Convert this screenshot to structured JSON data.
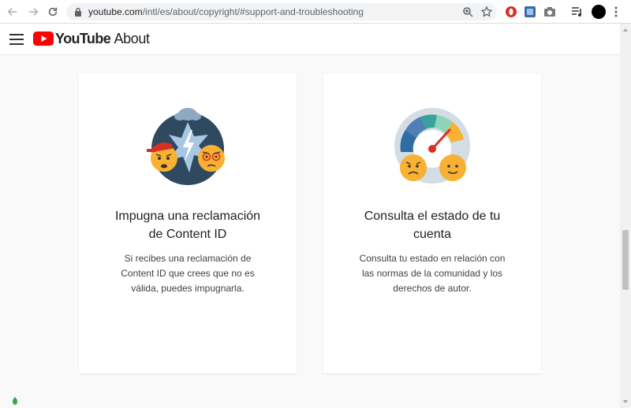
{
  "browser": {
    "url_host": "youtube.com",
    "url_path": "/intl/es/about/copyright/#support-and-troubleshooting"
  },
  "header": {
    "brand_name": "YouTube",
    "brand_suffix": "About"
  },
  "cards": [
    {
      "title_line1": "Impugna una reclamación",
      "title_line2": "de Content ID",
      "text_line1": "Si recibes una reclamación de",
      "text_line2": "Content ID  que crees que no es",
      "text_line3": "válida, puedes impugnarla."
    },
    {
      "title_line1": "Consulta el estado de tu",
      "title_line2": "cuenta",
      "text_line1": "Consulta tu estado en relación con",
      "text_line2": "las normas de la comunidad y los",
      "text_line3": "derechos de autor."
    }
  ],
  "colors": {
    "yt_red": "#ff0000",
    "card_bg": "#ffffff",
    "page_bg": "#f9f9f9"
  }
}
